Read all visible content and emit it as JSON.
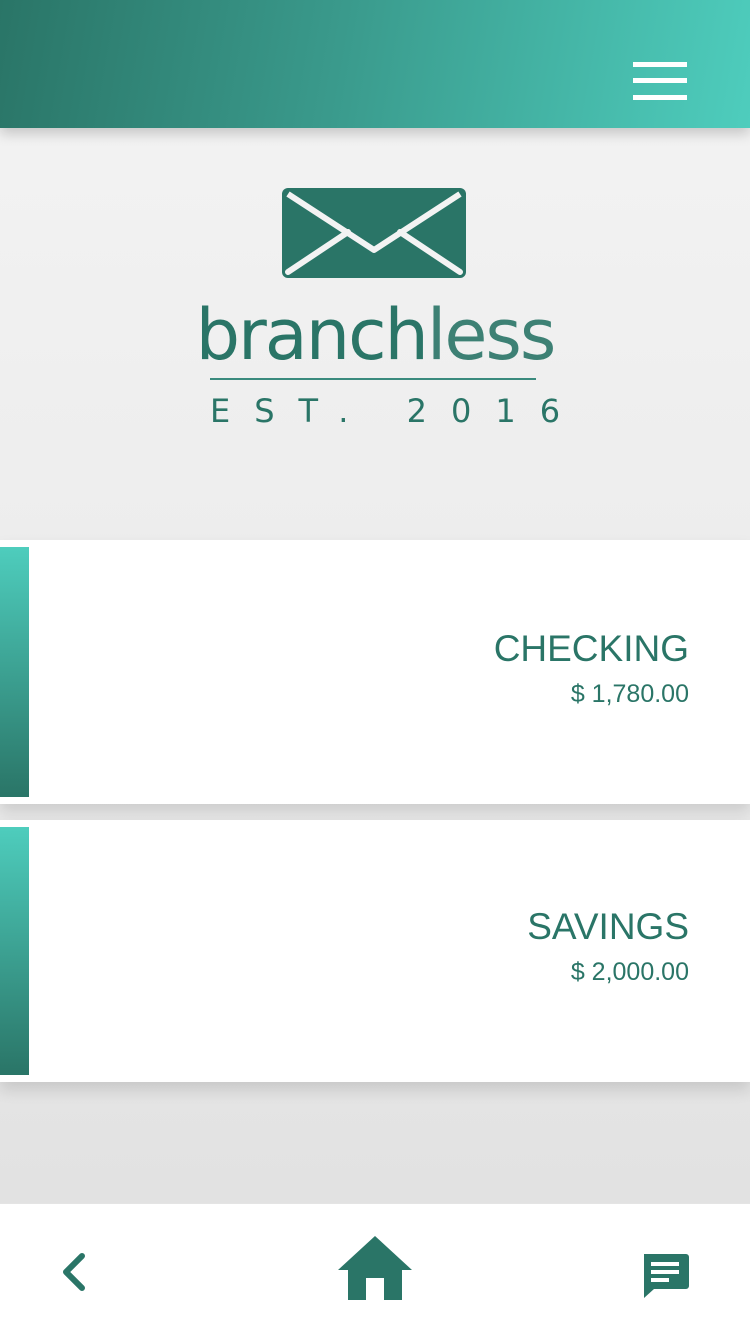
{
  "header": {
    "menu_icon": "hamburger-menu-icon",
    "gradient_start": "#2a7567",
    "gradient_end": "#4ecdbd"
  },
  "brand": {
    "logo_icon": "envelope-icon",
    "name_bold": "branch",
    "name_light": "less",
    "tagline": "EST. 2016",
    "color": "#2a7567"
  },
  "accounts": [
    {
      "name": "CHECKING",
      "balance": "$ 1,780.00"
    },
    {
      "name": "SAVINGS",
      "balance": "$ 2,000.00"
    }
  ],
  "bottom_nav": {
    "back_icon": "chevron-left-icon",
    "home_icon": "home-icon",
    "chat_icon": "chat-icon"
  }
}
